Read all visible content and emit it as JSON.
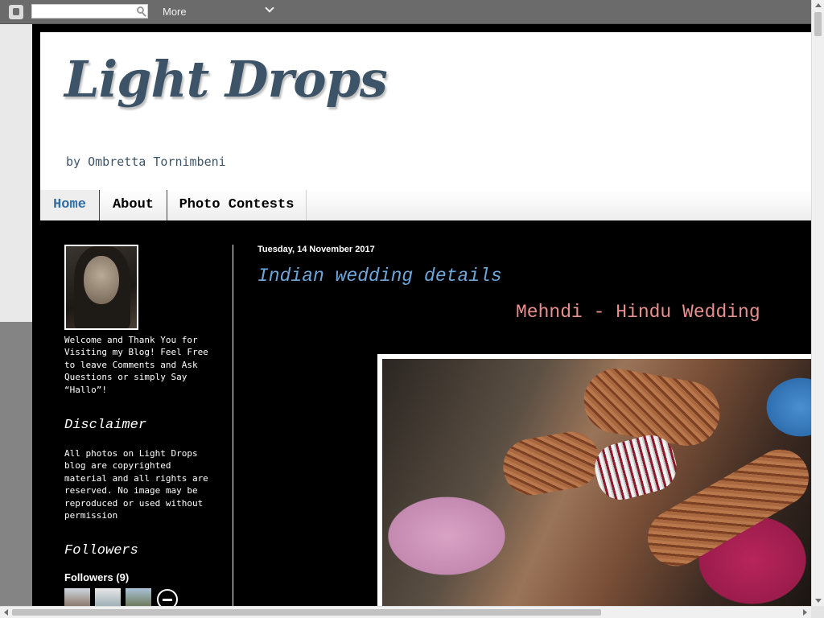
{
  "navbar": {
    "logo_icon": "blogger-icon",
    "search_placeholder": "",
    "search_icon": "search-icon",
    "more_label": "More",
    "more_icon": "chevron-down-icon"
  },
  "header": {
    "title": "Light Drops",
    "description": "by Ombretta Tornimbeni",
    "title_color": "#3d5468"
  },
  "tabs": [
    {
      "label": "Home",
      "active": true
    },
    {
      "label": "About",
      "active": false
    },
    {
      "label": "Photo Contests",
      "active": false
    }
  ],
  "sidebar": {
    "welcome_text": "Welcome and Thank You for Visiting my Blog! Feel Free to leave Comments and Ask Questions or simply Say “Hallo”!",
    "disclaimer_title": "Disclaimer",
    "disclaimer_text": "All photos on Light Drops blog are copyrighted material and all rights are reserved. No image may be reproduced or used without permission",
    "followers_title": "Followers",
    "followers_count": "Followers (9)",
    "follow_icon": "follow-minus-icon"
  },
  "post": {
    "date": "Tuesday, 14 November 2017",
    "title": "Indian wedding details",
    "subtitle": "Mehndi - Hindu Wedding",
    "title_color": "#6fa6d8",
    "subtitle_color": "#e88f8f"
  }
}
